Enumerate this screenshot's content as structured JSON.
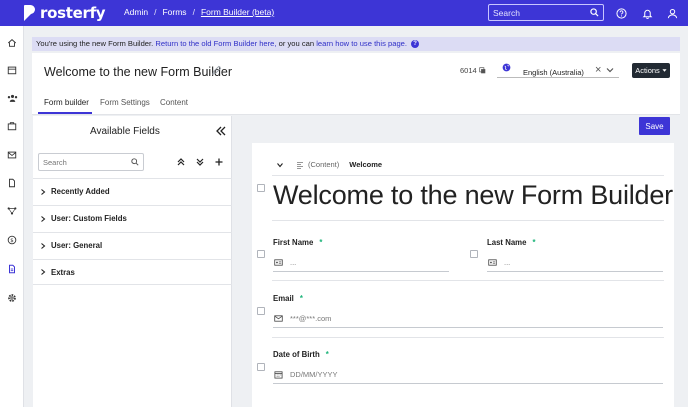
{
  "app": {
    "logo_text": "rosterfy"
  },
  "nav": {
    "breadcrumbs": [
      "Admin",
      "Forms",
      "Form Builder (beta)"
    ],
    "search_placeholder": "Search"
  },
  "banner": {
    "prefix": "You're using the new Form Builder.",
    "link_old": "Return to the old Form Builder here,",
    "middle": "or you can",
    "link_learn": "learn how to use this page.",
    "info_glyph": "?"
  },
  "header": {
    "title": "Welcome to the new Form Builder",
    "form_id": "6014",
    "language": "English (Australia)",
    "clear_glyph": "×",
    "actions_label": "Actions"
  },
  "tabs": [
    {
      "label": "Form builder",
      "active": true
    },
    {
      "label": "Form Settings",
      "active": false
    },
    {
      "label": "Content",
      "active": false
    }
  ],
  "fields_panel": {
    "title": "Available Fields",
    "search_placeholder": "Search",
    "groups": [
      "Recently Added",
      "User: Custom Fields",
      "User: General",
      "Extras"
    ]
  },
  "canvas": {
    "save_label": "Save",
    "section_tag": "(Content)",
    "section_name": "Welcome",
    "heading": "Welcome to the new Form Builder",
    "fields": [
      {
        "label": "First Name",
        "required_mark": "*",
        "placeholder": "...",
        "icon": "id-card-icon"
      },
      {
        "label": "Last Name",
        "required_mark": "*",
        "placeholder": "...",
        "icon": "id-card-icon"
      },
      {
        "label": "Email",
        "required_mark": "*",
        "placeholder": "***@***.com",
        "icon": "envelope-icon"
      },
      {
        "label": "Date of Birth",
        "required_mark": "*",
        "placeholder": "DD/MM/YYYY",
        "icon": "calendar-icon"
      }
    ]
  },
  "colors": {
    "brand": "#3d35d6",
    "required": "#1db47a",
    "actions_bg": "#222a33"
  }
}
